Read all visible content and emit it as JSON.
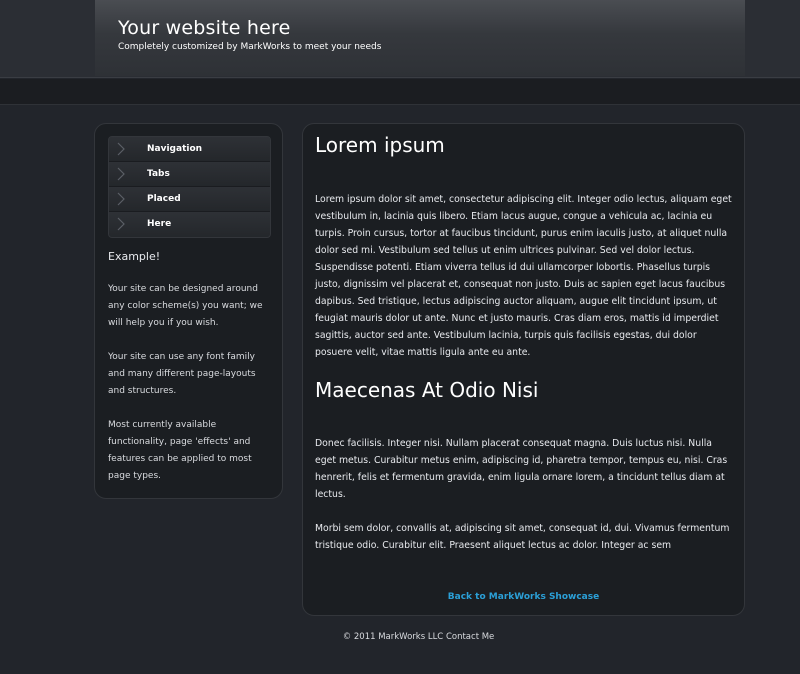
{
  "header": {
    "title": "Your website here",
    "subtitle": "Completely customized by MarkWorks to meet your needs"
  },
  "sidebar": {
    "nav": [
      {
        "label": "Navigation"
      },
      {
        "label": "Tabs"
      },
      {
        "label": "Placed"
      },
      {
        "label": "Here"
      }
    ],
    "heading": "Example!",
    "paragraphs": [
      "Your site can be designed around any color scheme(s) you want; we will help you if you wish.",
      "Your site can use any font family and many different page-layouts and structures.",
      "Most currently available functionality, page 'effects' and features can be applied to most page types."
    ]
  },
  "main": {
    "heading1": "Lorem ipsum",
    "paragraph1": "Lorem ipsum dolor sit amet, consectetur adipiscing elit. Integer odio lectus, aliquam eget vestibulum in, lacinia quis libero. Etiam lacus augue, congue a vehicula ac, lacinia eu turpis. Proin cursus, tortor at faucibus tincidunt, purus enim iaculis justo, at aliquet nulla dolor sed mi. Vestibulum sed tellus ut enim ultrices pulvinar. Sed vel dolor lectus. Suspendisse potenti. Etiam viverra tellus id dui ullamcorper lobortis. Phasellus turpis justo, dignissim vel placerat et, consequat non justo. Duis ac sapien eget lacus faucibus dapibus. Sed tristique, lectus adipiscing auctor aliquam, augue elit tincidunt ipsum, ut feugiat mauris dolor ut ante. Nunc et justo mauris. Cras diam eros, mattis id imperdiet sagittis, auctor sed ante. Vestibulum lacinia, turpis quis facilisis egestas, dui dolor posuere velit, vitae mattis ligula ante eu ante.",
    "heading2": "Maecenas At Odio Nisi",
    "paragraph2": "Donec facilisis. Integer nisi. Nullam placerat consequat magna. Duis luctus nisi. Nulla eget metus. Curabitur metus enim, adipiscing id, pharetra tempor, tempus eu, nisi. Cras henrerit, felis et fermentum gravida, enim ligula ornare lorem, a tincidunt tellus diam at lectus.",
    "paragraph3": "Morbi sem dolor, convallis at, adipiscing sit amet, consequat id, dui. Vivamus fermentum tristique odio. Curabitur elit. Praesent aliquet lectus ac dolor. Integer ac sem",
    "back_link": "Back to MarkWorks Showcase"
  },
  "footer": {
    "copyright": "© 2011 MarkWorks LLC",
    "contact": "Contact Me"
  },
  "colors": {
    "background": "#22252b",
    "panel": "#1b1e22",
    "link": "#2ba0d8",
    "text": "#e8eaee"
  }
}
